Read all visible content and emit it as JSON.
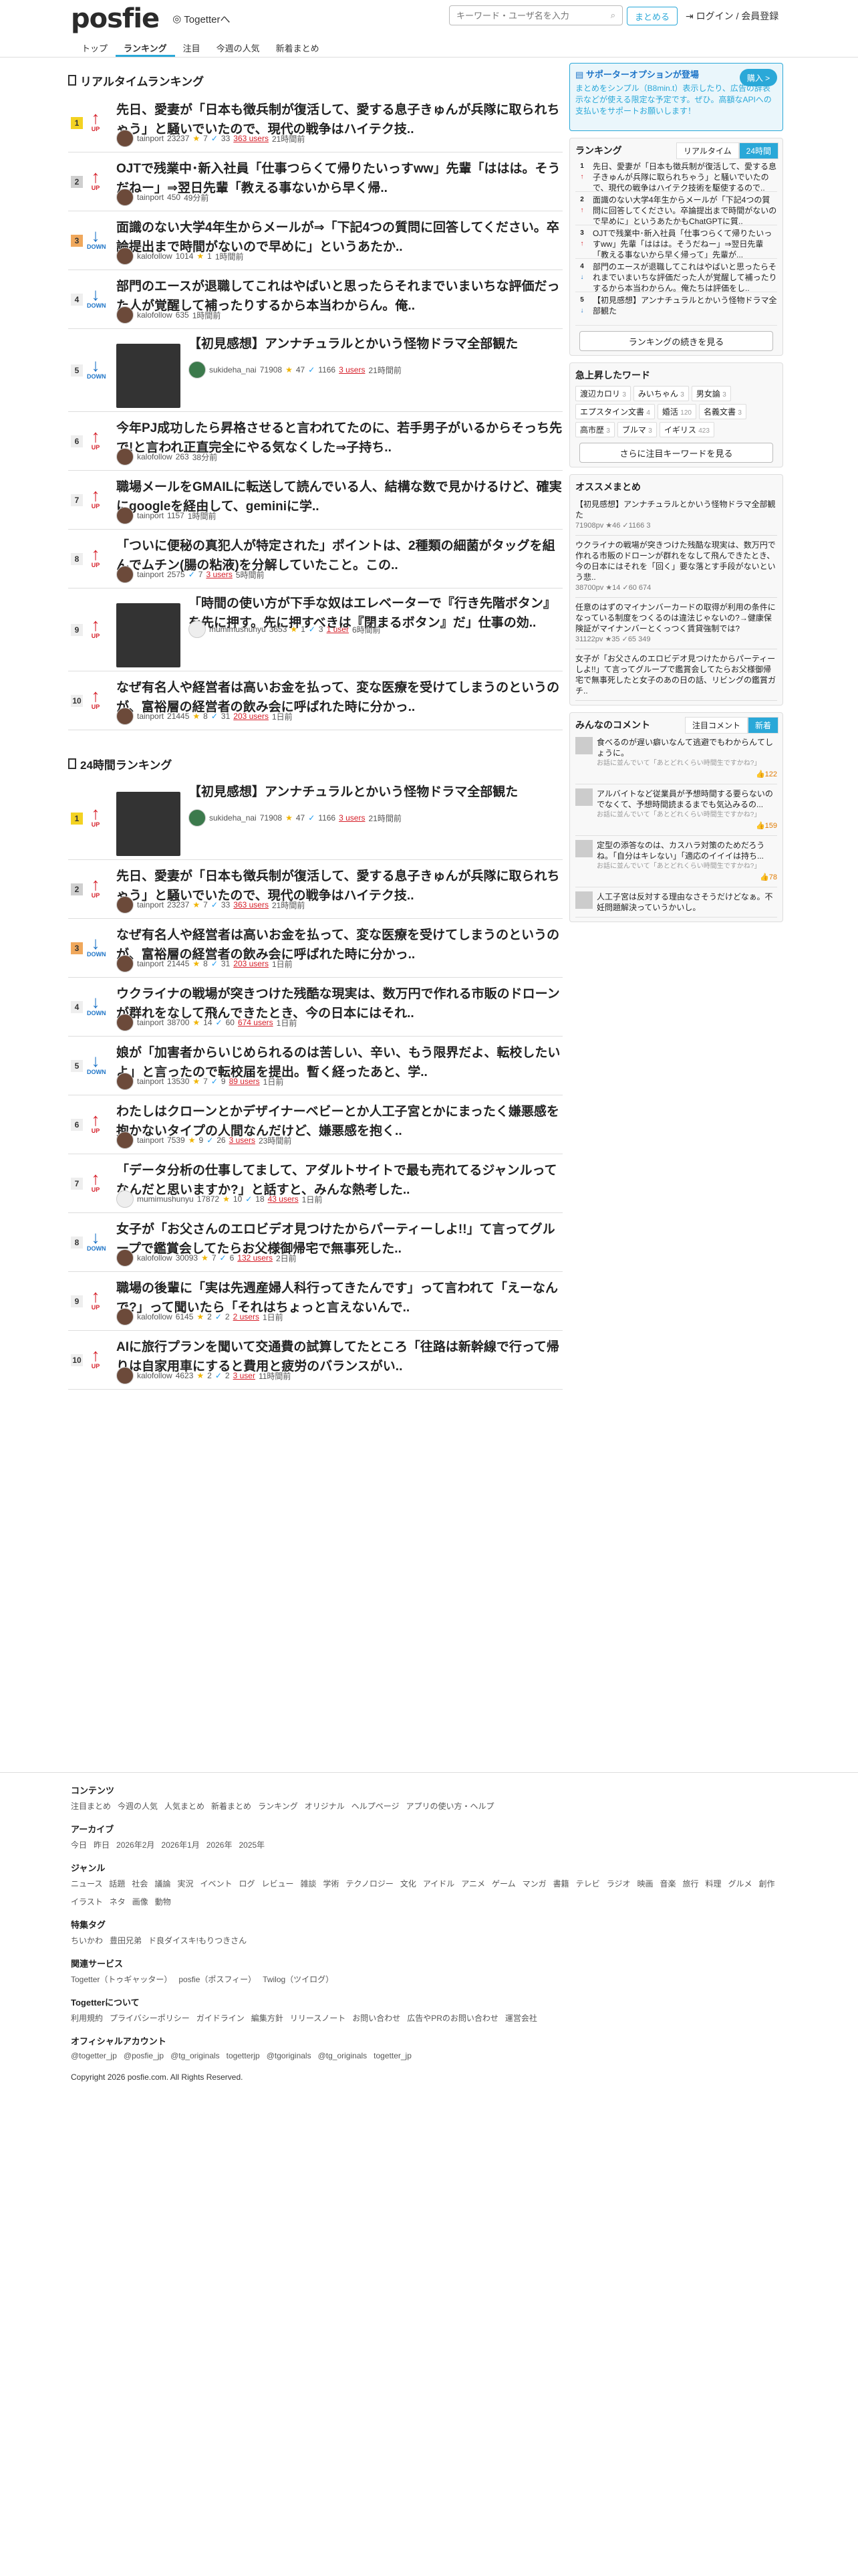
{
  "header": {
    "logo": "posfie",
    "togetter_link": "Togetterへ",
    "search_placeholder": "キーワード・ユーザ名を入力",
    "matome_button": "まとめる",
    "login": "ログイン / 会員登録"
  },
  "nav": [
    "トップ",
    "ランキング",
    "注目",
    "今週の人気",
    "新着まとめ"
  ],
  "realtime": {
    "title": "リアルタイムランキング",
    "items": [
      {
        "rank": "1",
        "dir": "UP",
        "title": "先日、愛妻が「日本も徴兵制が復活して、愛する息子きゅんが兵隊に取られちゃう」と騒いでいたので、現代の戦争はハイテク技..",
        "user": "tainport",
        "pv": "23237",
        "stars": "7",
        "tweets": "33",
        "users": "363 users",
        "time": "21時間前"
      },
      {
        "rank": "2",
        "dir": "UP",
        "title": "OJTで残業中･新入社員「仕事つらくて帰りたいっすww」先輩「ははは。そうだねー」⇒翌日先輩「教える事ないから早く帰..",
        "user": "tainport",
        "pv": "",
        "stars": "",
        "tweets": "",
        "users": "",
        "time": "49分前",
        "views": "450"
      },
      {
        "rank": "3",
        "dir": "DOWN",
        "title": "面識のない大学4年生からメールが⇒「下記4つの質問に回答してください。卒論提出まで時間がないので早めに」というあたか..",
        "user": "kalofollow",
        "pv": "1014",
        "stars": "1",
        "tweets": "",
        "users": "",
        "time": "1時間前"
      },
      {
        "rank": "4",
        "dir": "DOWN",
        "title": "部門のエースが退職してこれはやばいと思ったらそれまでいまいちな評価だった人が覚醒して補ったりするから本当わからん。俺..",
        "user": "kalofollow",
        "pv": "635",
        "stars": "",
        "tweets": "",
        "users": "",
        "time": "1時間前"
      },
      {
        "rank": "5",
        "dir": "DOWN",
        "title": "【初見感想】アンナチュラルとかいう怪物ドラマ全部観た",
        "user": "sukideha_nai",
        "pv": "71908",
        "stars": "47",
        "tweets": "1166",
        "users": "3 users",
        "time": "21時間前"
      },
      {
        "rank": "6",
        "dir": "UP",
        "title": "今年PJ成功したら昇格させると言われてたのに、若手男子がいるからそっち先で!と言われ正直完全にやる気なくした⇒子持ち..",
        "user": "kalofollow",
        "pv": "263",
        "stars": "",
        "tweets": "",
        "users": "",
        "time": "38分前"
      },
      {
        "rank": "7",
        "dir": "UP",
        "title": "職場メールをGMAILに転送して読んでいる人、結構な数で見かけるけど、確実にgoogleを経由して、geminiに学..",
        "user": "tainport",
        "pv": "1157",
        "stars": "",
        "tweets": "",
        "users": "",
        "time": "1時間前"
      },
      {
        "rank": "8",
        "dir": "UP",
        "title": "「ついに便秘の真犯人が特定された」ポイントは、2種類の細菌がタッグを組んでムチン(腸の粘液)を分解していたこと。この..",
        "user": "tainport",
        "pv": "2575",
        "stars": "",
        "tweets": "7",
        "users": "3 users",
        "time": "5時間前"
      },
      {
        "rank": "9",
        "dir": "UP",
        "title": "「時間の使い方が下手な奴はエレベーターで『行き先階ボタン』を先に押す。先に押すべきは『閉まるボタン』だ」仕事の効..",
        "user": "mumimushunyu",
        "pv": "3653",
        "stars": "1",
        "tweets": "3",
        "users": "1 user",
        "time": "6時間前"
      },
      {
        "rank": "10",
        "dir": "UP",
        "title": "なぜ有名人や経営者は高いお金を払って、変な医療を受けてしまうのというのが、富裕層の経営者の飲み会に呼ばれた時に分かっ..",
        "user": "tainport",
        "pv": "21445",
        "stars": "8",
        "tweets": "31",
        "users": "203 users",
        "time": "1日前"
      }
    ]
  },
  "daily": {
    "title": "24時間ランキング",
    "items": [
      {
        "rank": "1",
        "dir": "UP",
        "title": "【初見感想】アンナチュラルとかいう怪物ドラマ全部観た",
        "user": "sukideha_nai",
        "pv": "71908",
        "stars": "47",
        "tweets": "1166",
        "users": "3 users",
        "time": "21時間前"
      },
      {
        "rank": "2",
        "dir": "UP",
        "title": "先日、愛妻が「日本も徴兵制が復活して、愛する息子きゅんが兵隊に取られちゃう」と騒いでいたので、現代の戦争はハイテク技..",
        "user": "tainport",
        "pv": "23237",
        "stars": "7",
        "tweets": "33",
        "users": "363 users",
        "time": "21時間前"
      },
      {
        "rank": "3",
        "dir": "DOWN",
        "title": "なぜ有名人や経営者は高いお金を払って、変な医療を受けてしまうのというのが、富裕層の経営者の飲み会に呼ばれた時に分かっ..",
        "user": "tainport",
        "pv": "21445",
        "stars": "8",
        "tweets": "31",
        "users": "203 users",
        "time": "1日前"
      },
      {
        "rank": "4",
        "dir": "DOWN",
        "title": "ウクライナの戦場が突きつけた残酷な現実は、数万円で作れる市販のドローンが群れをなして飛んできたとき、今の日本にはそれ..",
        "user": "tainport",
        "pv": "38700",
        "stars": "14",
        "tweets": "60",
        "users": "674 users",
        "time": "1日前"
      },
      {
        "rank": "5",
        "dir": "DOWN",
        "title": "娘が「加害者からいじめられるのは苦しい、辛い、もう限界だよ、転校したいよ」と言ったので転校届を提出。暫く経ったあと、学..",
        "user": "tainport",
        "pv": "13530",
        "stars": "7",
        "tweets": "9",
        "users": "89 users",
        "time": "1日前"
      },
      {
        "rank": "6",
        "dir": "UP",
        "title": "わたしはクローンとかデザイナーベビーとか人工子宮とかにまったく嫌悪感を抱かないタイプの人間なんだけど、嫌悪感を抱く..",
        "user": "tainport",
        "pv": "7539",
        "stars": "9",
        "tweets": "26",
        "users": "3 users",
        "time": "23時間前"
      },
      {
        "rank": "7",
        "dir": "UP",
        "title": "「データ分析の仕事してまして、アダルトサイトで最も売れてるジャンルってなんだと思いますか?」と話すと、みんな熱考した..",
        "user": "mumimushunyu",
        "pv": "17872",
        "stars": "10",
        "tweets": "18",
        "users": "43 users",
        "time": "1日前"
      },
      {
        "rank": "8",
        "dir": "DOWN",
        "title": "女子が「お父さんのエロビデオ見つけたからパーティーしよ!!」て言ってグループで鑑賞会してたらお父様御帰宅で無事死した..",
        "user": "kalofollow",
        "pv": "30093",
        "stars": "7",
        "tweets": "6",
        "users": "132 users",
        "time": "2日前"
      },
      {
        "rank": "9",
        "dir": "UP",
        "title": "職場の後輩に「実は先週産婦人科行ってきたんです」って言われて「えーなんで?」って聞いたら「それはちょっと言えないんで..",
        "user": "kalofollow",
        "pv": "6145",
        "stars": "2",
        "tweets": "2",
        "users": "2 users",
        "time": "1日前"
      },
      {
        "rank": "10",
        "dir": "UP",
        "title": "AIに旅行プランを聞いて交通費の試算してたところ「往路は新幹線で行って帰りは自家用車にすると費用と疲労のバランスがい..",
        "user": "kalofollow",
        "pv": "4623",
        "stars": "2",
        "tweets": "2",
        "users": "3 user",
        "time": "11時間前"
      }
    ]
  },
  "sidebar": {
    "support": {
      "title": "サポーターオプションが登場",
      "body": "まとめをシンプル（B8min.t）表示したり、広告の辞表示などが使える限定な予定です。ぜひ。高額なAPIへの支払いをサポートお願いします！",
      "button": "購入 >"
    },
    "ranking": {
      "title": "ランキング",
      "tab_rt": "リアルタイム",
      "tab_24": "24時間",
      "rows": [
        {
          "n": "1",
          "d": "UP",
          "t": "先日、愛妻が「日本も徴兵制が復活して、愛する息子きゅんが兵隊に取られちゃう」と騒いでいたので、現代の戦争はハイテク技術を駆使するので.."
        },
        {
          "n": "2",
          "d": "UP",
          "t": "面識のない大学4年生からメールが「下記4つの質問に回答してください。卒論提出まで時間がないので早めに」というあたかもChatGPTに質.."
        },
        {
          "n": "3",
          "d": "UP",
          "t": "OJTで残業中･新入社員「仕事つらくて帰りたいっすww」先輩「ははは。そうだねー」⇒翌日先輩「教える事ないから早く帰って」先輩が..."
        },
        {
          "n": "4",
          "d": "DOWN",
          "t": "部門のエースが退職してこれはやばいと思ったらそれまでいまいちな評価だった人が覚醒して補ったりするから本当わからん。俺たちは評価をし.."
        },
        {
          "n": "5",
          "d": "DOWN",
          "t": "【初見感想】アンナチュラルとかいう怪物ドラマ全部観た"
        }
      ],
      "more": "ランキングの続きを見る"
    },
    "keywords": {
      "title": "急上昇したワード",
      "items": [
        {
          "w": "渡辺カロリ",
          "c": "3"
        },
        {
          "w": "みいちゃん",
          "c": "3"
        },
        {
          "w": "男女論",
          "c": "3"
        },
        {
          "w": "エプスタイン文書",
          "c": "4"
        },
        {
          "w": "婚活",
          "c": "120"
        },
        {
          "w": "名義文書",
          "c": "3"
        },
        {
          "w": "高市歴",
          "c": "3"
        },
        {
          "w": "ブルマ",
          "c": "3"
        },
        {
          "w": "イギリス",
          "c": "423"
        }
      ],
      "more": "さらに注目キーワードを見る"
    },
    "recommend": {
      "title": "オススメまとめ",
      "items": [
        {
          "t": "【初見感想】アンナチュラルとかいう怪物ドラマ全部観た",
          "m": "71908pv ★46 ✓1166 3"
        },
        {
          "t": "ウクライナの戦場が突きつけた残酷な現実は、数万円で作れる市販のドローンが群れをなして飛んできたとき、今の日本にはそれを「回く」要な落とす手段がないという悲..",
          "m": "38700pv ★14 ✓60 674"
        },
        {
          "t": "任意のはずのマイナンバーカードの取得が利用の条件になっている制度をつくるのは違法じゃないの?→健康保険証がマイナンバーとくっつく賃貸強制では?",
          "m": "31122pv ★35 ✓65 349"
        },
        {
          "t": "女子が「お父さんのエロビデオ見つけたからパーティーしよ!!」て言ってグループで鑑賞会してたらお父様御帰宅で無事死したと女子のあの日の話、リビングの鑑賞ガチ..",
          "m": ""
        }
      ]
    },
    "comments": {
      "title": "みんなのコメント",
      "tab1": "注目コメント",
      "tab2": "新着",
      "items": [
        {
          "t": "食べるのが遅い癖いなんて逃避でもわからんてしょうに。",
          "q": "お話に並んでいて「あとどれくらい時間生ですかね?」",
          "n": "122"
        },
        {
          "t": "アルバイトなど従業員が予想時間する要らないのでなくて、予想時間読まるまでも気込みるの...",
          "q": "お話に並んでいて「あとどれくらい時間生ですかね?」",
          "n": "159"
        },
        {
          "t": "定型の添答なのは、カスハラ対策のためだろうね。「自分はキレない」「適応のイイイは持ち...",
          "q": "お話に並んでいて「あとどれくらい時間生ですかね?」",
          "n": "78"
        },
        {
          "t": "人工子宮は反対する理由なさそうだけどなぁ。不妊問題解決っていうかいし。",
          "q": "",
          "n": ""
        }
      ]
    }
  },
  "footer": {
    "contents": {
      "title": "コンテンツ",
      "links": [
        "注目まとめ",
        "今週の人気",
        "人気まとめ",
        "新着まとめ",
        "ランキング",
        "オリジナル",
        "ヘルプページ",
        "アプリの使い方・ヘルプ"
      ]
    },
    "archive": {
      "title": "アーカイブ",
      "links": [
        "今日",
        "昨日",
        "2026年2月",
        "2026年1月",
        "2026年",
        "2025年"
      ]
    },
    "genre": {
      "title": "ジャンル",
      "links": [
        "ニュース",
        "話題",
        "社会",
        "議論",
        "実況",
        "イベント",
        "ログ",
        "レビュー",
        "雑談",
        "学術",
        "テクノロジー",
        "文化",
        "アイドル",
        "アニメ",
        "ゲーム",
        "マンガ",
        "書籍",
        "テレビ",
        "ラジオ",
        "映画",
        "音楽",
        "旅行",
        "料理",
        "グルメ",
        "創作",
        "イラスト",
        "ネタ",
        "画像",
        "動物"
      ]
    },
    "tags": {
      "title": "特集タグ",
      "links": [
        "ちいかわ",
        "豊田兄弟",
        "ド良ダイスキ!もりつきさん"
      ]
    },
    "related": {
      "title": "関連サービス",
      "links": [
        "Togetter（トゥギャッター）",
        "posfie（ポスフィー）",
        "Twilog（ツイログ）"
      ]
    },
    "about": {
      "title": "Togetterについて",
      "links": [
        "利用規約",
        "プライバシーポリシー",
        "ガイドライン",
        "編集方針",
        "リリースノート",
        "お問い合わせ",
        "広告やPRのお問い合わせ",
        "運営会社"
      ]
    },
    "official": {
      "title": "オフィシャルアカウント",
      "links": [
        "@togetter_jp",
        "@posfie_jp",
        "@tg_originals",
        "togetterjp",
        "@tgoriginals",
        "@tg_originals",
        "togetter_jp"
      ]
    },
    "copyright": "Copyright 2026 posfie.com. All Rights Reserved."
  }
}
